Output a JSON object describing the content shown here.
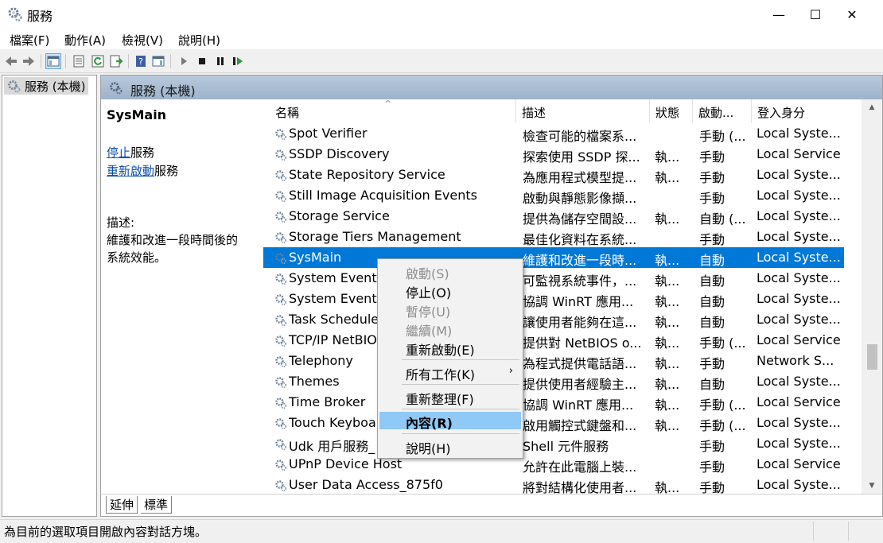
{
  "window": {
    "title": "服務",
    "minimize_label": "—",
    "maximize_label": "☐",
    "close_label": "✕"
  },
  "menubar": [
    "檔案(F)",
    "動作(A)",
    "檢視(V)",
    "說明(H)"
  ],
  "tree": {
    "root": "服務 (本機)"
  },
  "pane": {
    "header": "服務 (本機)"
  },
  "description": {
    "service_name": "SysMain",
    "stop_link": "停止",
    "stop_suffix": "服務",
    "restart_link": "重新啟動",
    "restart_suffix": "服務",
    "desc_label": "描述:",
    "desc_line1": "維護和改進一段時間後的",
    "desc_line2": "系統效能。"
  },
  "columns": {
    "name": "名稱",
    "desc": "描述",
    "status": "狀態",
    "startup": "啟動...",
    "logon": "登入身分"
  },
  "rows": [
    {
      "name": "Spot Verifier",
      "desc": "檢查可能的檔案系...",
      "status": "",
      "startup": "手動 (...",
      "logon": "Local Syste..."
    },
    {
      "name": "SSDP Discovery",
      "desc": "探索使用 SSDP 探...",
      "status": "執...",
      "startup": "手動",
      "logon": "Local Service"
    },
    {
      "name": "State Repository Service",
      "desc": "為應用程式模型提...",
      "status": "執...",
      "startup": "手動",
      "logon": "Local Syste..."
    },
    {
      "name": "Still Image Acquisition Events",
      "desc": "啟動與靜態影像擷...",
      "status": "",
      "startup": "手動",
      "logon": "Local Syste..."
    },
    {
      "name": "Storage Service",
      "desc": "提供為儲存空間設...",
      "status": "執...",
      "startup": "自動 (...",
      "logon": "Local Syste..."
    },
    {
      "name": "Storage Tiers Management",
      "desc": "最佳化資料在系統...",
      "status": "",
      "startup": "手動",
      "logon": "Local Syste..."
    },
    {
      "name": "SysMain",
      "desc": "維護和改進一段時...",
      "status": "執...",
      "startup": "自動",
      "logon": "Local Syste...",
      "selected": true
    },
    {
      "name": "System Event",
      "desc": "可監視系統事件，...",
      "status": "執...",
      "startup": "自動",
      "logon": "Local Syste..."
    },
    {
      "name": "System Events",
      "desc": "協調 WinRT 應用...",
      "status": "執...",
      "startup": "自動",
      "logon": "Local Syste..."
    },
    {
      "name": "Task Schedule",
      "desc": "讓使用者能夠在這...",
      "status": "執...",
      "startup": "自動",
      "logon": "Local Syste..."
    },
    {
      "name": "TCP/IP NetBIO",
      "desc": "提供對 NetBIOS o...",
      "status": "執...",
      "startup": "手動 (...",
      "logon": "Local Service"
    },
    {
      "name": "Telephony",
      "desc": "為程式提供電話語...",
      "status": "執...",
      "startup": "手動",
      "logon": "Network S..."
    },
    {
      "name": "Themes",
      "desc": "提供使用者經驗主...",
      "status": "執...",
      "startup": "自動",
      "logon": "Local Syste..."
    },
    {
      "name": "Time Broker",
      "desc": "協調 WinRT 應用...",
      "status": "執...",
      "startup": "手動 (...",
      "logon": "Local Service"
    },
    {
      "name": "Touch Keyboa",
      "desc": "啟用觸控式鍵盤和...",
      "status": "執...",
      "startup": "手動 (...",
      "logon": "Local Syste..."
    },
    {
      "name": "Udk 用戶服務_",
      "desc": "Shell 元件服務",
      "status": "",
      "startup": "手動",
      "logon": "Local Syste..."
    },
    {
      "name": "UPnP Device Host",
      "desc": "允許在此電腦上裝...",
      "status": "",
      "startup": "手動",
      "logon": "Local Service"
    },
    {
      "name": "User Data Access_875f0",
      "desc": "將對結構化使用者...",
      "status": "執...",
      "startup": "手動",
      "logon": "Local Syste..."
    }
  ],
  "tabs": {
    "extended": "延伸",
    "standard": "標準"
  },
  "status_bar": "為目前的選取項目開啟內容對話方塊。",
  "context_menu": {
    "start": "啟動(S)",
    "stop": "停止(O)",
    "pause": "暫停(U)",
    "resume": "繼續(M)",
    "restart": "重新啟動(E)",
    "all_tasks": "所有工作(K)",
    "refresh": "重新整理(F)",
    "properties": "內容(R)",
    "help": "說明(H)"
  }
}
